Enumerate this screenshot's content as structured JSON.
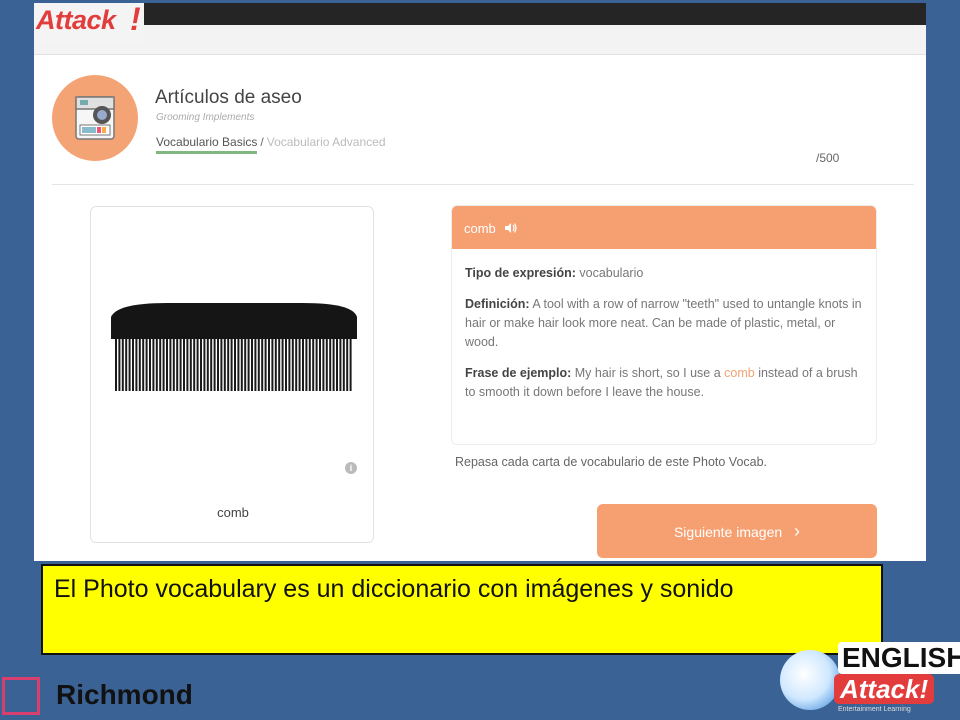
{
  "top_logo": {
    "text": "Attack",
    "mark": "!"
  },
  "lesson": {
    "title": "Artículos de aseo",
    "subtitle": "Grooming Implements",
    "breadcrumb_active": "Vocabulario Basics",
    "breadcrumb_sep": "/",
    "breadcrumb_inactive": "Vocabulario Advanced",
    "counter": "/500"
  },
  "image_card": {
    "caption": "comb",
    "info_icon": "i"
  },
  "word_card": {
    "word": "comb",
    "speaker_icon": "speaker-icon",
    "type_label": "Tipo de expresión:",
    "type_value": " vocabulario",
    "def_label": "Definición:",
    "def_value": " A tool with a row of narrow \"teeth\" used to untangle knots in hair or make hair look more neat. Can be made of plastic, metal, or wood.",
    "example_label": "Frase de ejemplo:",
    "example_before": " My hair is short, so I use a ",
    "example_highlight": "comb",
    "example_after": " instead of a brush to smooth it down before I leave the house."
  },
  "note": "Repasa cada carta de vocabulario de este Photo Vocab.",
  "next_button": {
    "label": "Siguiente imagen",
    "chevron": "›"
  },
  "slide_caption": "El Photo vocabulary es un diccionario con imágenes y sonido",
  "footer": {
    "richmond": "Richmond",
    "ea_english": "ENGLISH",
    "ea_attack": "Attack!",
    "ea_tagline": "Entertainment Learning"
  },
  "colors": {
    "accent": "#f69f70",
    "background": "#3b6294",
    "highlight": "#ffff00",
    "underline": "#7fb77e"
  }
}
